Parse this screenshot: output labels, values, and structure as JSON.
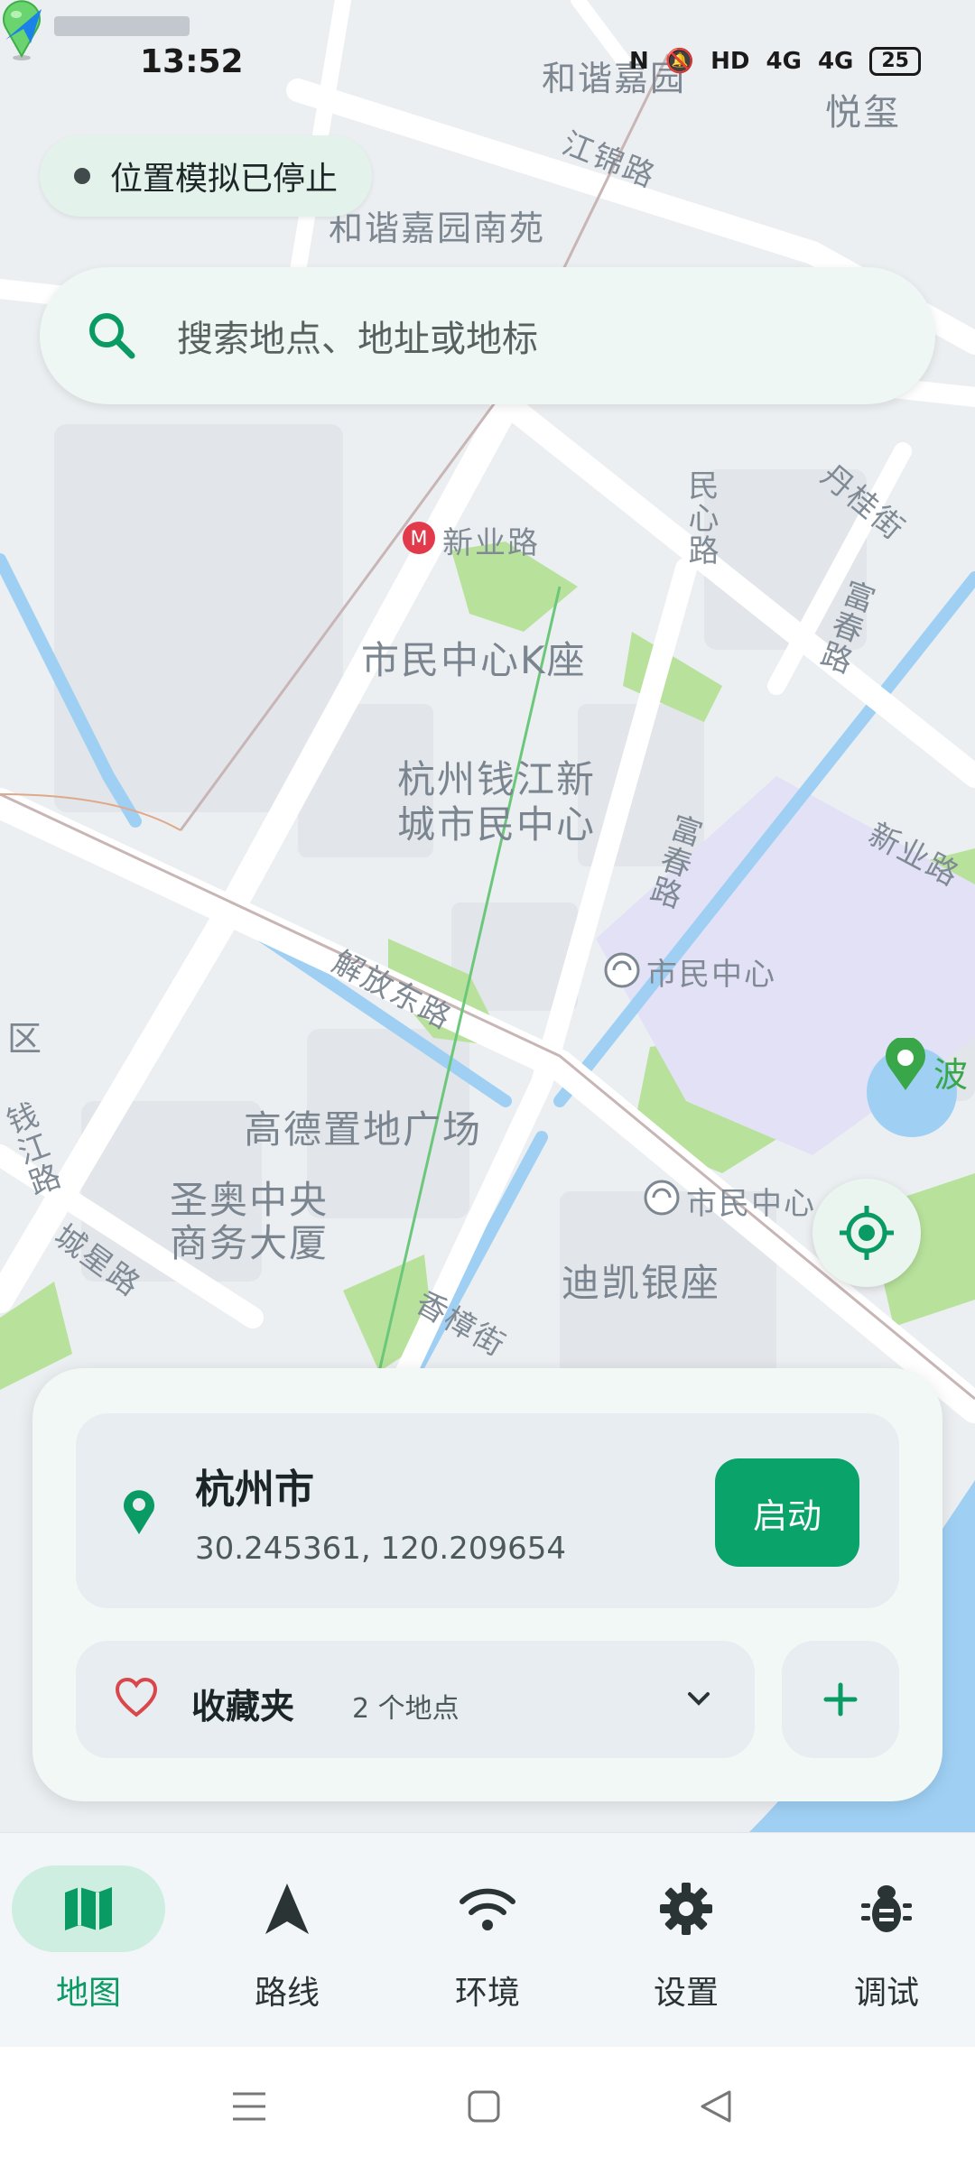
{
  "status_bar": {
    "time": "13:52",
    "network": "4G",
    "battery": "25"
  },
  "simulation_status": {
    "text": "位置模拟已停止"
  },
  "search": {
    "placeholder": "搜索地点、地址或地标"
  },
  "map": {
    "labels": {
      "hexie_garden": "和谐嘉园",
      "hexie_south": "和谐嘉园南苑",
      "yuexi": "悦玺",
      "jiangjin_rd": "江锦路",
      "xinye_rd_metro": "新业路",
      "minxin_rd": "民心路",
      "dangui_st": "丹桂街",
      "fuchun_rd": "富春路",
      "fuchun_rd2": "富春路",
      "citizen_k": "市民中心K座",
      "hz_center_1": "杭州钱江新",
      "hz_center_2": "城市民中心",
      "jiefang_e_rd": "解放东路",
      "citizen_center_metro1": "市民中心",
      "citizen_center_metro2": "市民中心",
      "xinye_rd2": "新业路",
      "gaode_plaza": "高德置地广场",
      "shengao_1": "圣奥中央",
      "shengao_2": "商务大厦",
      "chengxing_rd": "城星路",
      "xiangzhang_st": "香樟街",
      "dikai": "迪凯银座",
      "bo": "波",
      "qianjiang_rd": "钱江路",
      "district": "区"
    }
  },
  "location_card": {
    "city": "杭州市",
    "coords": "30.245361, 120.209654",
    "start_label": "启动"
  },
  "favorites": {
    "title": "收藏夹",
    "count": "2 个地点"
  },
  "nav": {
    "items": [
      {
        "label": "地图",
        "icon": "map-icon",
        "active": true
      },
      {
        "label": "路线",
        "icon": "navigation-arrow-icon",
        "active": false
      },
      {
        "label": "环境",
        "icon": "wifi-icon",
        "active": false
      },
      {
        "label": "设置",
        "icon": "gear-icon",
        "active": false
      },
      {
        "label": "调试",
        "icon": "bug-icon",
        "active": false
      }
    ]
  },
  "colors": {
    "accent": "#0aa36a",
    "map_green": "#b8e29c",
    "water": "#9fd0f4"
  }
}
